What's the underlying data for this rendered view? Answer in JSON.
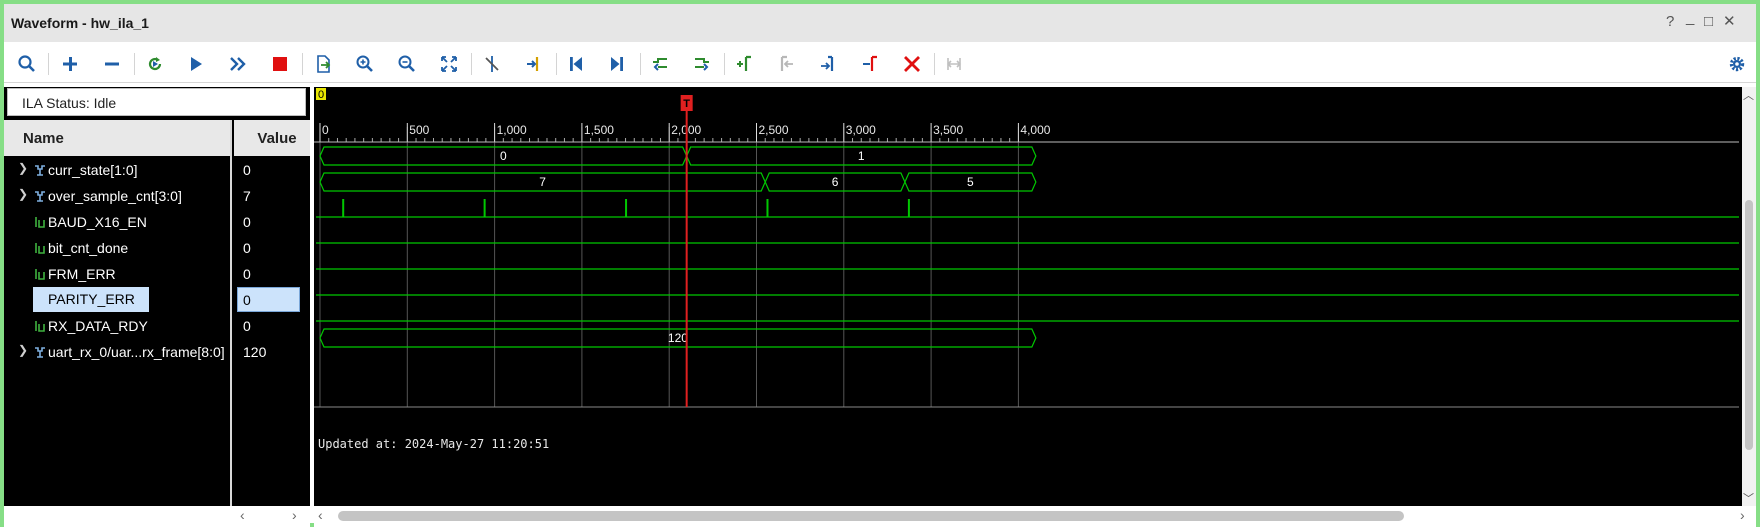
{
  "window": {
    "title": "Waveform - hw_ila_1",
    "controls": [
      "?",
      "_",
      "□",
      "✕"
    ]
  },
  "toolbar": {
    "buttons": [
      "search-icon",
      "add-icon",
      "remove-icon",
      "run-trigger-immediate-icon",
      "run-trigger-icon",
      "run-continuous-icon",
      "stop-icon",
      "export-icon",
      "zoom-in-icon",
      "zoom-out-icon",
      "zoom-fit-icon",
      "cursor-cut-icon",
      "marker-add-icon",
      "go-to-start-icon",
      "go-to-end-icon",
      "prev-transition-icon",
      "next-transition-icon",
      "add-marker-icon",
      "prev-marker-icon",
      "next-marker-icon",
      "swap-cursor-icon",
      "delete-icon",
      "snap-icon"
    ],
    "settings_icon": "gear-icon"
  },
  "status": {
    "ila_status": "ILA Status: Idle"
  },
  "columns": {
    "name": "Name",
    "value": "Value"
  },
  "signals": [
    {
      "name": "curr_state[1:0]",
      "value": "0",
      "kind": "bus",
      "expandable": true
    },
    {
      "name": "over_sample_cnt[3:0]",
      "value": "7",
      "kind": "bus",
      "expandable": true
    },
    {
      "name": "BAUD_X16_EN",
      "value": "0",
      "kind": "bit",
      "expandable": false
    },
    {
      "name": "bit_cnt_done",
      "value": "0",
      "kind": "bit",
      "expandable": false
    },
    {
      "name": "FRM_ERR",
      "value": "0",
      "kind": "bit",
      "expandable": false
    },
    {
      "name": "PARITY_ERR",
      "value": "0",
      "kind": "bit",
      "expandable": false,
      "selected": true
    },
    {
      "name": "RX_DATA_RDY",
      "value": "0",
      "kind": "bit",
      "expandable": false
    },
    {
      "name": "uart_rx_0/uar...rx_frame[8:0]",
      "value": "120",
      "kind": "bus",
      "expandable": true
    }
  ],
  "waveform": {
    "marker_label": "0",
    "trigger_label": "T",
    "trigger_sample": 2100,
    "timeline_labels": [
      "0",
      "500",
      "1,000",
      "1,500",
      "2,000",
      "2,500",
      "3,000",
      "3,500",
      "4,000"
    ],
    "updated_at": "Updated at: 2024-May-27 11:20:51",
    "curr_state_segments": [
      {
        "label": "0",
        "from": 0,
        "to": 2100
      },
      {
        "label": "1",
        "from": 2100,
        "to": 4100
      }
    ],
    "over_sample_cnt_segments": [
      {
        "label": "7",
        "from": 0,
        "to": 2550
      },
      {
        "label": "6",
        "from": 2550,
        "to": 3350
      },
      {
        "label": "5",
        "from": 3350,
        "to": 4100
      }
    ],
    "baud_pulses": [
      130,
      940,
      1750,
      2560,
      3370
    ],
    "rx_frame_segments": [
      {
        "label": "120",
        "from": 0,
        "to": 4100
      }
    ]
  },
  "colors": {
    "wave": "#00c800",
    "cursor": "#e02020",
    "background": "#000000",
    "border": "#86de86"
  }
}
